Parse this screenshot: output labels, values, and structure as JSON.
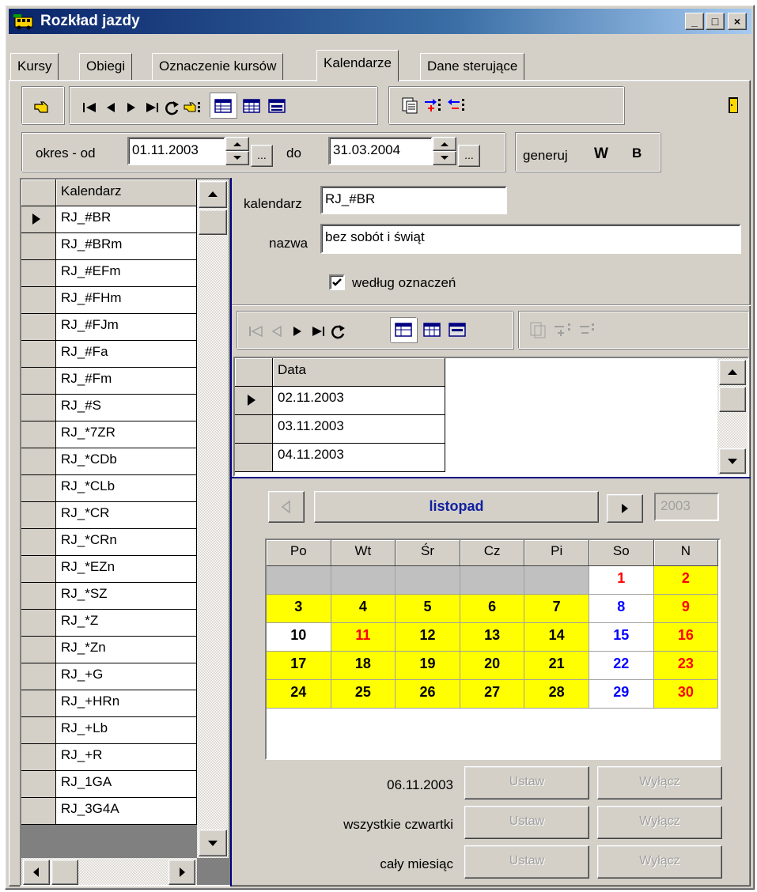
{
  "window": {
    "title": "Rozkład jazdy",
    "caption_buttons": {
      "minimize": "_",
      "maximize": "□",
      "close": "×"
    }
  },
  "tabs": [
    {
      "label": "Kursy",
      "active": false
    },
    {
      "label": "Obiegi",
      "active": false
    },
    {
      "label": "Oznaczenie kursów",
      "active": false
    },
    {
      "label": "Kalendarze",
      "active": true
    },
    {
      "label": "Dane sterujące",
      "active": false
    }
  ],
  "period": {
    "from_label": "okres - od",
    "from_value": "01.11.2003",
    "to_label": "do",
    "to_value": "31.03.2004",
    "ellipsis": "...",
    "generate_label": "generuj",
    "generate_w": "W",
    "generate_b": "B"
  },
  "calendar_list": {
    "header": "Kalendarz",
    "items": [
      "RJ_#BR",
      "RJ_#BRm",
      "RJ_#EFm",
      "RJ_#FHm",
      "RJ_#FJm",
      "RJ_#Fa",
      "RJ_#Fm",
      "RJ_#S",
      "RJ_*7ZR",
      "RJ_*CDb",
      "RJ_*CLb",
      "RJ_*CR",
      "RJ_*CRn",
      "RJ_*EZn",
      "RJ_*SZ",
      "RJ_*Z",
      "RJ_*Zn",
      "RJ_+G",
      "RJ_+HRn",
      "RJ_+Lb",
      "RJ_+R",
      "RJ_1GA",
      "RJ_3G4A"
    ]
  },
  "detail": {
    "kalendarz_label": "kalendarz",
    "kalendarz_value": "RJ_#BR",
    "nazwa_label": "nazwa",
    "nazwa_value": "bez sobót i świąt",
    "checkbox_label": "według oznaczeń",
    "checkbox_checked": true
  },
  "dates": {
    "header": "Data",
    "items": [
      "02.11.2003",
      "03.11.2003",
      "04.11.2003"
    ]
  },
  "month": {
    "name": "listopad",
    "year": "2003",
    "weekdays": [
      "Po",
      "Wt",
      "Śr",
      "Cz",
      "Pi",
      "So",
      "N"
    ],
    "weeks": [
      [
        {
          "d": "",
          "bg": "gray",
          "fg": "black"
        },
        {
          "d": "",
          "bg": "gray",
          "fg": "black"
        },
        {
          "d": "",
          "bg": "gray",
          "fg": "black"
        },
        {
          "d": "",
          "bg": "gray",
          "fg": "black"
        },
        {
          "d": "",
          "bg": "gray",
          "fg": "black"
        },
        {
          "d": "1",
          "bg": "white",
          "fg": "red"
        },
        {
          "d": "2",
          "bg": "yellow",
          "fg": "red"
        }
      ],
      [
        {
          "d": "3",
          "bg": "yellow",
          "fg": "black"
        },
        {
          "d": "4",
          "bg": "yellow",
          "fg": "black"
        },
        {
          "d": "5",
          "bg": "yellow",
          "fg": "black"
        },
        {
          "d": "6",
          "bg": "yellow",
          "fg": "black"
        },
        {
          "d": "7",
          "bg": "yellow",
          "fg": "black"
        },
        {
          "d": "8",
          "bg": "white",
          "fg": "blue"
        },
        {
          "d": "9",
          "bg": "yellow",
          "fg": "red"
        }
      ],
      [
        {
          "d": "10",
          "bg": "white",
          "fg": "black"
        },
        {
          "d": "11",
          "bg": "yellow",
          "fg": "red"
        },
        {
          "d": "12",
          "bg": "yellow",
          "fg": "black"
        },
        {
          "d": "13",
          "bg": "yellow",
          "fg": "black"
        },
        {
          "d": "14",
          "bg": "yellow",
          "fg": "black"
        },
        {
          "d": "15",
          "bg": "white",
          "fg": "blue"
        },
        {
          "d": "16",
          "bg": "yellow",
          "fg": "red"
        }
      ],
      [
        {
          "d": "17",
          "bg": "yellow",
          "fg": "black"
        },
        {
          "d": "18",
          "bg": "yellow",
          "fg": "black"
        },
        {
          "d": "19",
          "bg": "yellow",
          "fg": "black"
        },
        {
          "d": "20",
          "bg": "yellow",
          "fg": "black"
        },
        {
          "d": "21",
          "bg": "yellow",
          "fg": "black"
        },
        {
          "d": "22",
          "bg": "white",
          "fg": "blue"
        },
        {
          "d": "23",
          "bg": "yellow",
          "fg": "red"
        }
      ],
      [
        {
          "d": "24",
          "bg": "yellow",
          "fg": "black"
        },
        {
          "d": "25",
          "bg": "yellow",
          "fg": "black"
        },
        {
          "d": "26",
          "bg": "yellow",
          "fg": "black"
        },
        {
          "d": "27",
          "bg": "yellow",
          "fg": "black"
        },
        {
          "d": "28",
          "bg": "yellow",
          "fg": "black"
        },
        {
          "d": "29",
          "bg": "white",
          "fg": "blue"
        },
        {
          "d": "30",
          "bg": "yellow",
          "fg": "red"
        }
      ]
    ]
  },
  "actions": [
    {
      "label": "06.11.2003",
      "set": "Ustaw",
      "off": "Wyłącz"
    },
    {
      "label": "wszystkie czwartki",
      "set": "Ustaw",
      "off": "Wyłącz"
    },
    {
      "label": "cały miesiąc",
      "set": "Ustaw",
      "off": "Wyłącz"
    }
  ],
  "colors": {
    "face": "#d4d0c8",
    "yellow": "#ffff00",
    "gray": "#c0c0c0",
    "red": "#ff0000",
    "blue": "#0000ff",
    "month_blue": "#1020a0",
    "title_blue": "#0a246a"
  }
}
